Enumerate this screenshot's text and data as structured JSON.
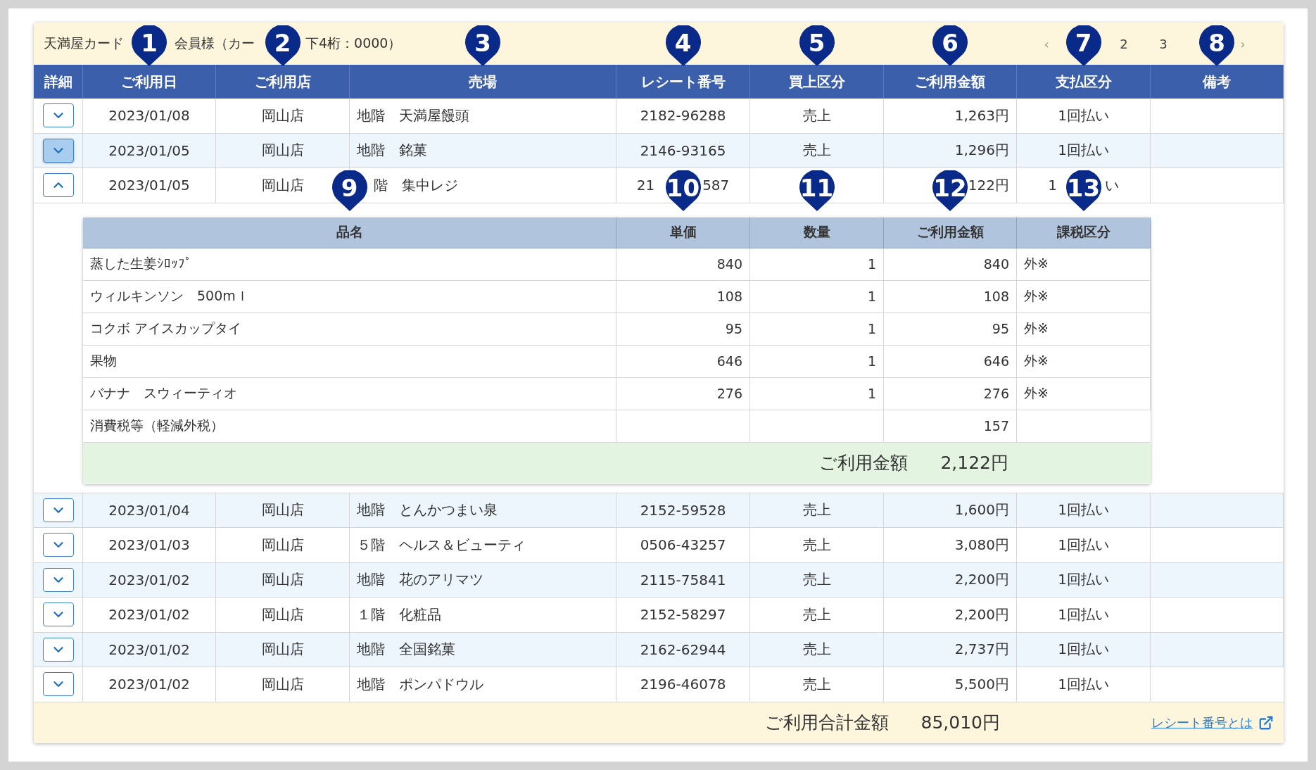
{
  "header": {
    "title_parts": [
      "天満屋カード",
      "会員様（カー",
      "下4桁：0000）"
    ],
    "pagination": [
      {
        "kind": "arrow",
        "label": "‹"
      },
      {
        "kind": "page",
        "label": "2"
      },
      {
        "kind": "page",
        "label": "3"
      },
      {
        "kind": "arrow",
        "label": "›"
      }
    ]
  },
  "table": {
    "columns": [
      {
        "label": "詳細"
      },
      {
        "label": "ご利用日",
        "marker": "1"
      },
      {
        "label": "ご利用店",
        "marker": "2"
      },
      {
        "label": "売場",
        "marker": "3"
      },
      {
        "label": "レシート番号",
        "marker": "4"
      },
      {
        "label": "買上区分",
        "marker": "5"
      },
      {
        "label": "ご利用金額",
        "marker": "6"
      },
      {
        "label": "支払区分",
        "marker": "7"
      },
      {
        "label": "備考",
        "marker": "8"
      }
    ],
    "rows": [
      {
        "expanded": false,
        "highlighted": false,
        "date": "2023/01/08",
        "store": "岡山店",
        "section": "地階　天満屋饅頭",
        "receipt": [
          "2182-96288"
        ],
        "type": "売上",
        "amount": "1,263円",
        "payment": [
          "1回払い"
        ]
      },
      {
        "expanded": false,
        "highlighted": true,
        "date": "2023/01/05",
        "store": "岡山店",
        "section": "地階　銘菓",
        "receipt": [
          "2146-93165"
        ],
        "type": "売上",
        "amount": "1,296円",
        "payment": [
          "1回払い"
        ]
      },
      {
        "expanded": true,
        "highlighted": false,
        "date": "2023/01/05",
        "store": "岡山店",
        "section": "階　集中レジ",
        "receipt": [
          "21",
          "587"
        ],
        "type": "",
        "amount": "122円",
        "payment": [
          "1",
          "い"
        ],
        "details": {
          "columns": [
            {
              "label": "品名",
              "marker": "9"
            },
            {
              "label": "単価",
              "marker": "10"
            },
            {
              "label": "数量",
              "marker": "11"
            },
            {
              "label": "ご利用金額",
              "marker": "12"
            },
            {
              "label": "課税区分",
              "marker": "13"
            }
          ],
          "items": [
            {
              "name": "蒸した生姜ｼﾛｯﾌﾟ",
              "price": "840",
              "qty": "1",
              "amount": "840",
              "tax": "外※"
            },
            {
              "name": "ウィルキンソン　500mｌ",
              "price": "108",
              "qty": "1",
              "amount": "108",
              "tax": "外※"
            },
            {
              "name": "コクボ アイスカップタイ",
              "price": "95",
              "qty": "1",
              "amount": "95",
              "tax": "外※"
            },
            {
              "name": "果物",
              "price": "646",
              "qty": "1",
              "amount": "646",
              "tax": "外※"
            },
            {
              "name": "バナナ　スウィーティオ",
              "price": "276",
              "qty": "1",
              "amount": "276",
              "tax": "外※"
            },
            {
              "name": "消費税等（軽減外税）",
              "amount": "157"
            }
          ],
          "total_label": "ご利用金額",
          "total_value": "2,122円"
        }
      },
      {
        "expanded": false,
        "highlighted": false,
        "date": "2023/01/04",
        "store": "岡山店",
        "section": "地階　とんかつまい泉",
        "receipt": [
          "2152-59528"
        ],
        "type": "売上",
        "amount": "1,600円",
        "payment": [
          "1回払い"
        ]
      },
      {
        "expanded": false,
        "highlighted": false,
        "date": "2023/01/03",
        "store": "岡山店",
        "section": "５階　ヘルス＆ビューティ",
        "receipt": [
          "0506-43257"
        ],
        "type": "売上",
        "amount": "3,080円",
        "payment": [
          "1回払い"
        ]
      },
      {
        "expanded": false,
        "highlighted": false,
        "date": "2023/01/02",
        "store": "岡山店",
        "section": "地階　花のアリマツ",
        "receipt": [
          "2115-75841"
        ],
        "type": "売上",
        "amount": "2,200円",
        "payment": [
          "1回払い"
        ]
      },
      {
        "expanded": false,
        "highlighted": false,
        "date": "2023/01/02",
        "store": "岡山店",
        "section": "１階　化粧品",
        "receipt": [
          "2152-58297"
        ],
        "type": "売上",
        "amount": "2,200円",
        "payment": [
          "1回払い"
        ]
      },
      {
        "expanded": false,
        "highlighted": false,
        "date": "2023/01/02",
        "store": "岡山店",
        "section": "地階　全国銘菓",
        "receipt": [
          "2162-62944"
        ],
        "type": "売上",
        "amount": "2,737円",
        "payment": [
          "1回払い"
        ]
      },
      {
        "expanded": false,
        "highlighted": false,
        "date": "2023/01/02",
        "store": "岡山店",
        "section": "地階　ポンパドウル",
        "receipt": [
          "2196-46078"
        ],
        "type": "売上",
        "amount": "5,500円",
        "payment": [
          "1回払い"
        ]
      }
    ]
  },
  "footer": {
    "total_label": "ご利用合計金額",
    "total_value": "85,010円",
    "link": "レシート番号とは"
  }
}
